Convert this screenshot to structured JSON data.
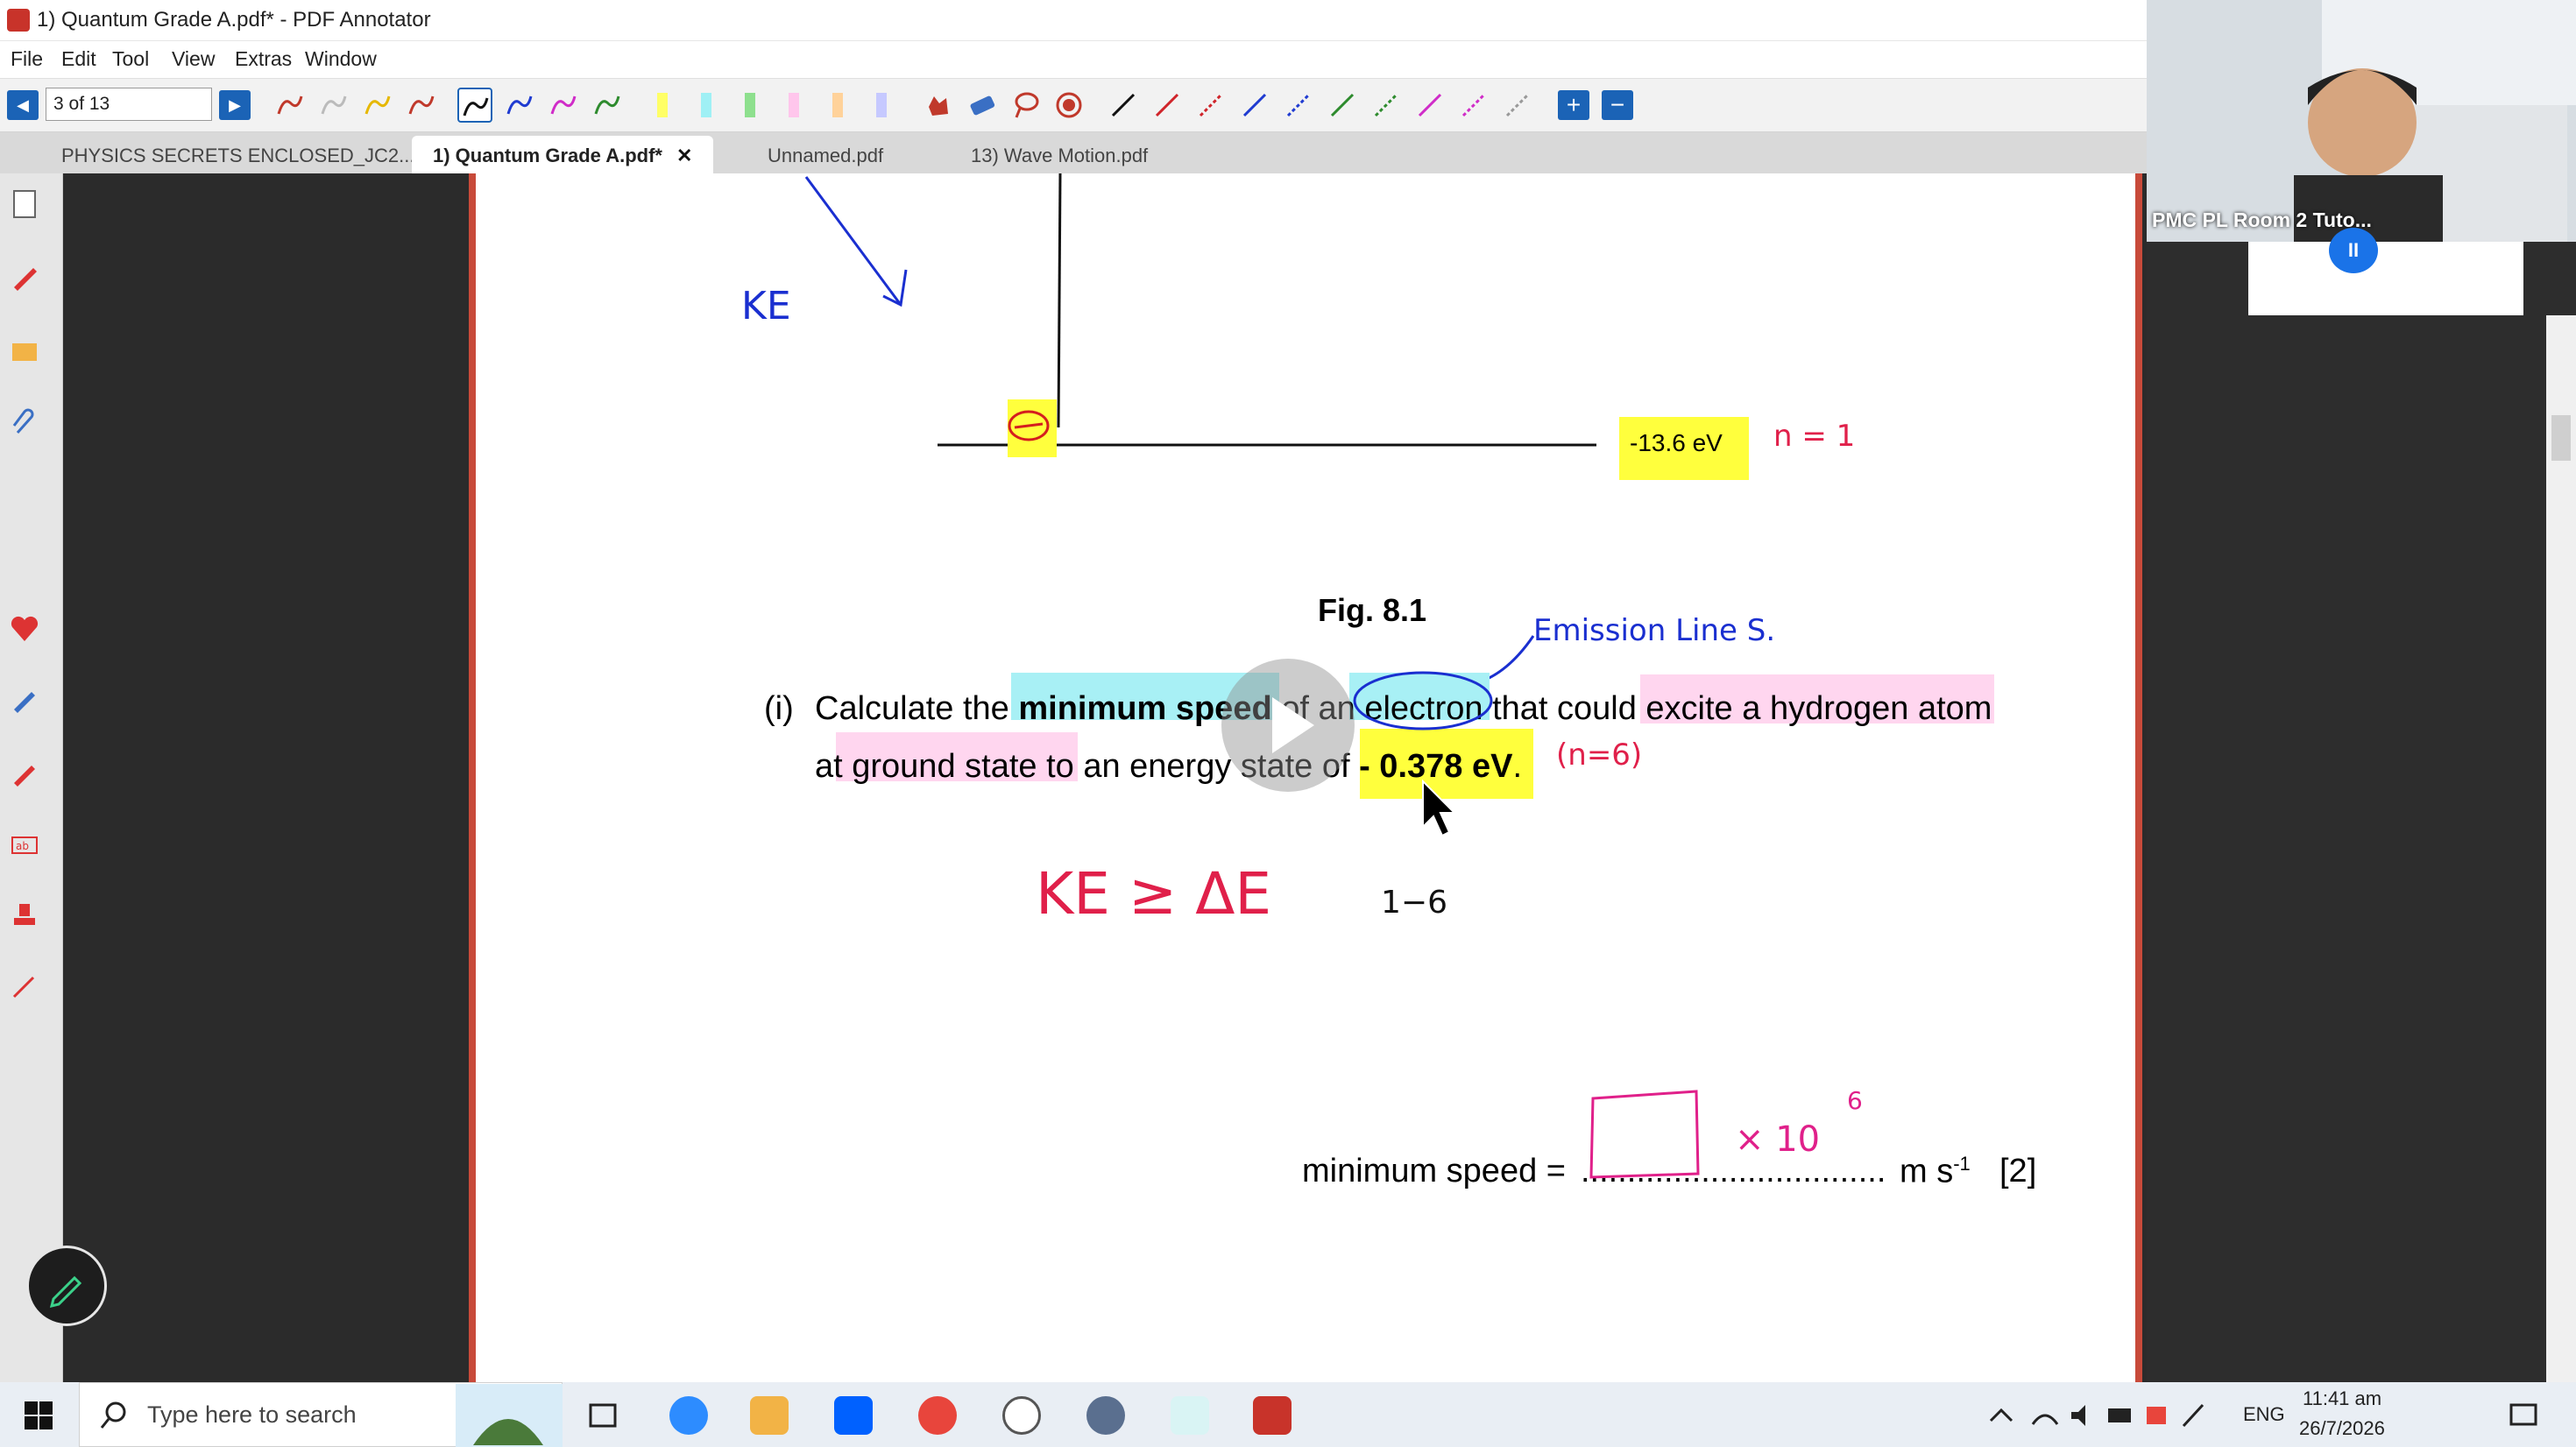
{
  "window": {
    "title": "1) Quantum Grade A.pdf* - PDF Annotator"
  },
  "menu": [
    "File",
    "Edit",
    "Tool",
    "View",
    "Extras",
    "Window"
  ],
  "toolbar": {
    "page_indicator": "3 of 13",
    "pen_colors": [
      "#c0392b",
      "#bbbbbb",
      "#e6b800",
      "#c0392b",
      "#111111",
      "#1f3bd1",
      "#d02cc8",
      "#2e8b2e"
    ],
    "highlighter_colors": [
      "#ffff66",
      "#9ff0f5",
      "#8ee08e",
      "#ffc6ec",
      "#ffd29a",
      "#c6c9ff"
    ],
    "line_colors": [
      "#111111",
      "#d0242a",
      "#d0242a",
      "#1f3bd1",
      "#1f3bd1",
      "#2e8b2e",
      "#2e8b2e",
      "#d02cc8",
      "#d02cc8",
      "#999999"
    ]
  },
  "tabs": [
    {
      "label": "PHYSICS SECRETS ENCLOSED_JC2..."
    },
    {
      "label": "1) Quantum Grade A.pdf*",
      "close": "✕"
    },
    {
      "label": "Unnamed.pdf"
    },
    {
      "label": "13)  Wave Motion.pdf"
    }
  ],
  "video": {
    "participant_label": "PMC PL Room 2 Tuto...",
    "pause_icon": "II"
  },
  "pdf": {
    "energy_label": "-13.6 eV",
    "level_label": "n = 1",
    "ke_top_label": "KE",
    "figure_caption": "Fig. 8.1",
    "emission_note": "Emission Line S.",
    "question_number": "(i)",
    "question_line1_parts": [
      "Calculate the ",
      "minimum speed",
      " of an ",
      "electron",
      " that could ",
      "excite a hydrogen atom"
    ],
    "question_line2_parts": [
      "at ground state",
      " to an energy state of ",
      "- 0.378 eV",
      "."
    ],
    "n6_note": "(n=6)",
    "ke_working": "KE  ≥  ΔE",
    "ke_subscript": "1−6",
    "answer_label": "minimum speed = ",
    "answer_dots": ".................................",
    "answer_unit": "m s",
    "answer_unit_exp": "-1",
    "answer_marks": "[2]",
    "times_ten": "× 10",
    "times_ten_exp": "6"
  },
  "taskbar": {
    "search_placeholder": "Type here to search",
    "language": "ENG",
    "time": "11:41 am",
    "date": "26/7/2026"
  }
}
